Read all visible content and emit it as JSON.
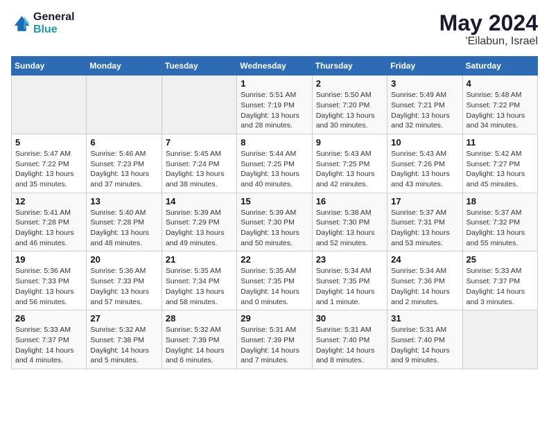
{
  "header": {
    "logo_line1": "General",
    "logo_line2": "Blue",
    "month_year": "May 2024",
    "location": "'Eilabun, Israel"
  },
  "days_of_week": [
    "Sunday",
    "Monday",
    "Tuesday",
    "Wednesday",
    "Thursday",
    "Friday",
    "Saturday"
  ],
  "weeks": [
    [
      {
        "day": "",
        "info": ""
      },
      {
        "day": "",
        "info": ""
      },
      {
        "day": "",
        "info": ""
      },
      {
        "day": "1",
        "info": "Sunrise: 5:51 AM\nSunset: 7:19 PM\nDaylight: 13 hours\nand 28 minutes."
      },
      {
        "day": "2",
        "info": "Sunrise: 5:50 AM\nSunset: 7:20 PM\nDaylight: 13 hours\nand 30 minutes."
      },
      {
        "day": "3",
        "info": "Sunrise: 5:49 AM\nSunset: 7:21 PM\nDaylight: 13 hours\nand 32 minutes."
      },
      {
        "day": "4",
        "info": "Sunrise: 5:48 AM\nSunset: 7:22 PM\nDaylight: 13 hours\nand 34 minutes."
      }
    ],
    [
      {
        "day": "5",
        "info": "Sunrise: 5:47 AM\nSunset: 7:22 PM\nDaylight: 13 hours\nand 35 minutes."
      },
      {
        "day": "6",
        "info": "Sunrise: 5:46 AM\nSunset: 7:23 PM\nDaylight: 13 hours\nand 37 minutes."
      },
      {
        "day": "7",
        "info": "Sunrise: 5:45 AM\nSunset: 7:24 PM\nDaylight: 13 hours\nand 38 minutes."
      },
      {
        "day": "8",
        "info": "Sunrise: 5:44 AM\nSunset: 7:25 PM\nDaylight: 13 hours\nand 40 minutes."
      },
      {
        "day": "9",
        "info": "Sunrise: 5:43 AM\nSunset: 7:25 PM\nDaylight: 13 hours\nand 42 minutes."
      },
      {
        "day": "10",
        "info": "Sunrise: 5:43 AM\nSunset: 7:26 PM\nDaylight: 13 hours\nand 43 minutes."
      },
      {
        "day": "11",
        "info": "Sunrise: 5:42 AM\nSunset: 7:27 PM\nDaylight: 13 hours\nand 45 minutes."
      }
    ],
    [
      {
        "day": "12",
        "info": "Sunrise: 5:41 AM\nSunset: 7:28 PM\nDaylight: 13 hours\nand 46 minutes."
      },
      {
        "day": "13",
        "info": "Sunrise: 5:40 AM\nSunset: 7:28 PM\nDaylight: 13 hours\nand 48 minutes."
      },
      {
        "day": "14",
        "info": "Sunrise: 5:39 AM\nSunset: 7:29 PM\nDaylight: 13 hours\nand 49 minutes."
      },
      {
        "day": "15",
        "info": "Sunrise: 5:39 AM\nSunset: 7:30 PM\nDaylight: 13 hours\nand 50 minutes."
      },
      {
        "day": "16",
        "info": "Sunrise: 5:38 AM\nSunset: 7:30 PM\nDaylight: 13 hours\nand 52 minutes."
      },
      {
        "day": "17",
        "info": "Sunrise: 5:37 AM\nSunset: 7:31 PM\nDaylight: 13 hours\nand 53 minutes."
      },
      {
        "day": "18",
        "info": "Sunrise: 5:37 AM\nSunset: 7:32 PM\nDaylight: 13 hours\nand 55 minutes."
      }
    ],
    [
      {
        "day": "19",
        "info": "Sunrise: 5:36 AM\nSunset: 7:33 PM\nDaylight: 13 hours\nand 56 minutes."
      },
      {
        "day": "20",
        "info": "Sunrise: 5:36 AM\nSunset: 7:33 PM\nDaylight: 13 hours\nand 57 minutes."
      },
      {
        "day": "21",
        "info": "Sunrise: 5:35 AM\nSunset: 7:34 PM\nDaylight: 13 hours\nand 58 minutes."
      },
      {
        "day": "22",
        "info": "Sunrise: 5:35 AM\nSunset: 7:35 PM\nDaylight: 14 hours\nand 0 minutes."
      },
      {
        "day": "23",
        "info": "Sunrise: 5:34 AM\nSunset: 7:35 PM\nDaylight: 14 hours\nand 1 minute."
      },
      {
        "day": "24",
        "info": "Sunrise: 5:34 AM\nSunset: 7:36 PM\nDaylight: 14 hours\nand 2 minutes."
      },
      {
        "day": "25",
        "info": "Sunrise: 5:33 AM\nSunset: 7:37 PM\nDaylight: 14 hours\nand 3 minutes."
      }
    ],
    [
      {
        "day": "26",
        "info": "Sunrise: 5:33 AM\nSunset: 7:37 PM\nDaylight: 14 hours\nand 4 minutes."
      },
      {
        "day": "27",
        "info": "Sunrise: 5:32 AM\nSunset: 7:38 PM\nDaylight: 14 hours\nand 5 minutes."
      },
      {
        "day": "28",
        "info": "Sunrise: 5:32 AM\nSunset: 7:39 PM\nDaylight: 14 hours\nand 6 minutes."
      },
      {
        "day": "29",
        "info": "Sunrise: 5:31 AM\nSunset: 7:39 PM\nDaylight: 14 hours\nand 7 minutes."
      },
      {
        "day": "30",
        "info": "Sunrise: 5:31 AM\nSunset: 7:40 PM\nDaylight: 14 hours\nand 8 minutes."
      },
      {
        "day": "31",
        "info": "Sunrise: 5:31 AM\nSunset: 7:40 PM\nDaylight: 14 hours\nand 9 minutes."
      },
      {
        "day": "",
        "info": ""
      }
    ]
  ]
}
